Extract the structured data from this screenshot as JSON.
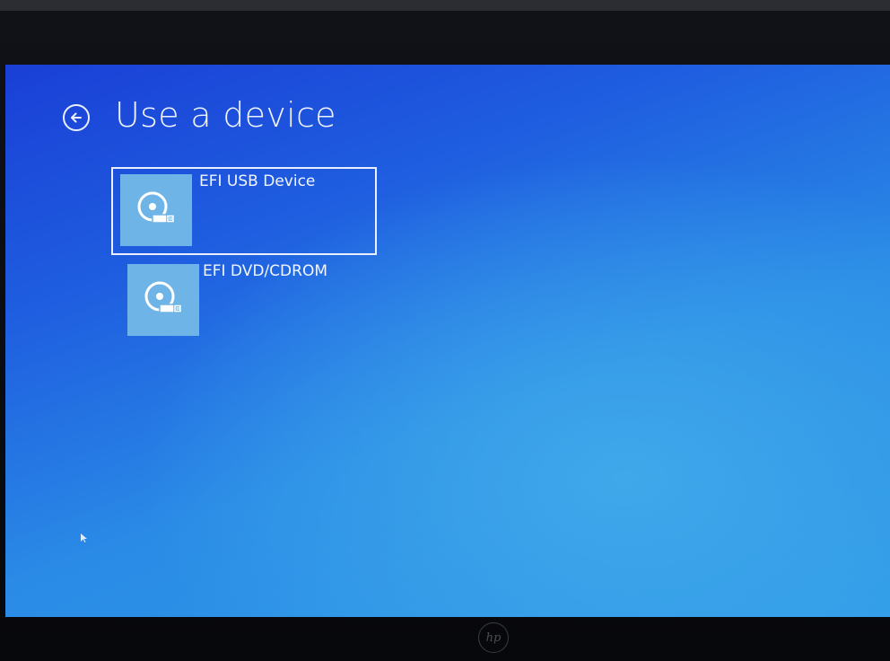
{
  "header": {
    "title": "Use a device",
    "back_icon": "back-arrow-circle-icon"
  },
  "devices": [
    {
      "label": "EFI USB Device",
      "icon": "disc-drive-icon",
      "selected": true
    },
    {
      "label": "EFI DVD/CDROM",
      "icon": "disc-drive-icon",
      "selected": false
    }
  ],
  "colors": {
    "background_top": "#1a3fd6",
    "background_bottom": "#2f9be8",
    "tile_icon_bg": "#6fb4e6",
    "text": "#eef3ff"
  },
  "bezel_logo": "hp"
}
